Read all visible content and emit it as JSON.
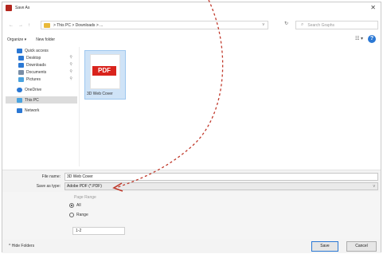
{
  "window": {
    "title": "Save As",
    "close_glyph": "✕"
  },
  "nav": {
    "back": "←",
    "forward": "→",
    "up": "↑",
    "address": "> This PC > Downloads > ...",
    "dropdown": "v",
    "refresh": "↻",
    "search_placeholder": "Search Graphs"
  },
  "toolbar": {
    "organize": "Organize ▾",
    "new_folder": "New folder",
    "view": "☷ ▾",
    "help": "?"
  },
  "sidebar": {
    "items": [
      {
        "label": "Quick access",
        "icon": "star-icon",
        "color": "#2b78d4"
      },
      {
        "label": "Desktop",
        "icon": "desktop-icon",
        "color": "#2b78d4",
        "pin": "⚲"
      },
      {
        "label": "Downloads",
        "icon": "download-icon",
        "color": "#2b78d4",
        "pin": "⚲"
      },
      {
        "label": "Documents",
        "icon": "document-icon",
        "color": "#7a8ea6",
        "pin": "⚲"
      },
      {
        "label": "Pictures",
        "icon": "pictures-icon",
        "color": "#4aa3df",
        "pin": "⚲"
      },
      {
        "label": "OneDrive",
        "icon": "cloud-icon",
        "color": "#2b78d4"
      },
      {
        "label": "This PC",
        "icon": "computer-icon",
        "color": "#4aa3df",
        "selected": true
      },
      {
        "label": "Network",
        "icon": "network-icon",
        "color": "#2b78d4"
      }
    ]
  },
  "file": {
    "badge": "PDF",
    "name": "3D Web Cover"
  },
  "form": {
    "file_name_label": "File name:",
    "file_name_value": "3D Web Cover",
    "save_type_label": "Save as type:",
    "save_type_value": "Adobe PDF (*.PDF)"
  },
  "options": {
    "heading": "Page Range",
    "all": "All",
    "range": "Range",
    "range_value": "1-2"
  },
  "footer": {
    "hide_folders": "^ Hide Folders",
    "save": "Save",
    "cancel": "Cancel"
  },
  "colors": {
    "accent": "#2b78d4",
    "arrow": "#c0392b",
    "pdf_red": "#d9231c"
  }
}
